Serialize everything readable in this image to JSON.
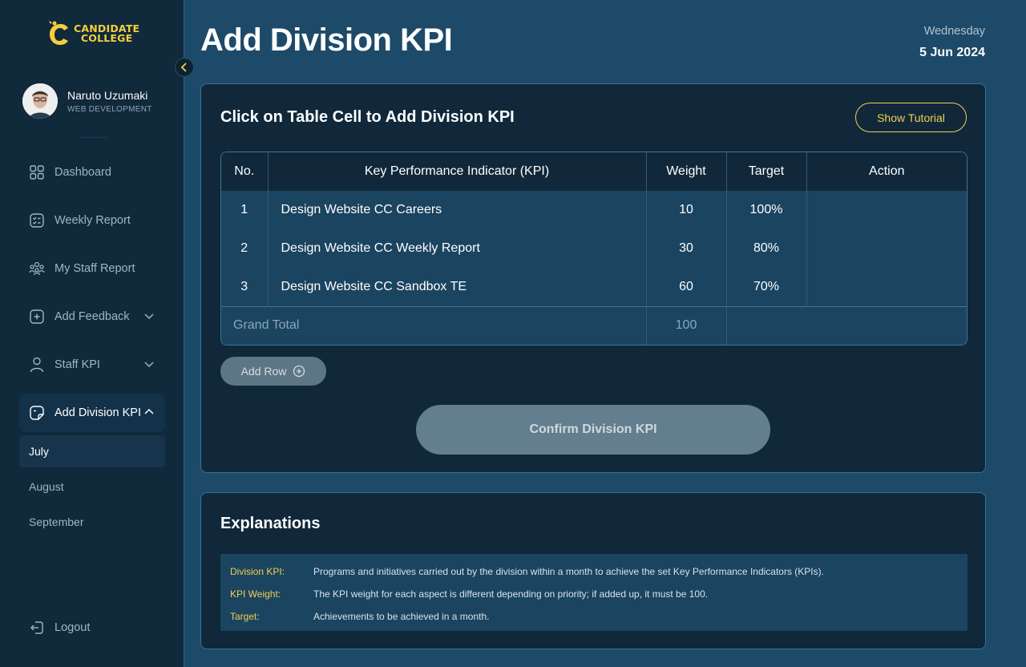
{
  "brand": {
    "line1": "CANDIDATE",
    "line2": "COLLEGE"
  },
  "profile": {
    "name": "Naruto Uzumaki",
    "role": "WEB DEVELOPMENT"
  },
  "nav": {
    "dashboard": "Dashboard",
    "weekly_report": "Weekly Report",
    "my_staff_report": "My Staff Report",
    "add_feedback": "Add Feedback",
    "staff_kpi": "Staff KPI",
    "add_division_kpi": "Add Division KPI",
    "logout": "Logout",
    "submenu": [
      "July",
      "August",
      "September"
    ]
  },
  "header": {
    "title": "Add Division KPI",
    "day": "Wednesday",
    "date": "5 Jun 2024"
  },
  "main": {
    "card_title": "Click on Table Cell to Add Division KPI",
    "tutorial_label": "Show Tutorial",
    "columns": [
      "No.",
      "Key Performance Indicator (KPI)",
      "Weight",
      "Target",
      "Action"
    ],
    "rows": [
      {
        "no": "1",
        "kpi": "Design Website CC Careers",
        "weight": "10",
        "target": "100%"
      },
      {
        "no": "2",
        "kpi": "Design Website CC Weekly Report",
        "weight": "30",
        "target": "80%"
      },
      {
        "no": "3",
        "kpi": "Design Website CC Sandbox TE",
        "weight": "60",
        "target": "70%"
      }
    ],
    "grand_total_label": "Grand Total",
    "grand_total_weight": "100",
    "add_row_label": "Add Row",
    "confirm_label": "Confirm Division KPI"
  },
  "explanations": {
    "title": "Explanations",
    "items": [
      {
        "term": "Division KPI:",
        "def": "Programs and initiatives carried out by the division within a month to achieve the set Key Performance Indicators (KPIs)."
      },
      {
        "term": "KPI Weight:",
        "def": "The KPI weight for each aspect is different depending on priority; if added up, it must be 100."
      },
      {
        "term": "Target:",
        "def": "Achievements to be achieved in a month."
      }
    ]
  },
  "colors": {
    "accent": "#f2cf50",
    "sidebar": "#10293b",
    "background": "#1d4a68",
    "card": "#10283a"
  },
  "icons": [
    "dashboard-grid-icon",
    "checklist-icon",
    "staff-group-icon",
    "plus-square-icon",
    "user-icon",
    "document-icon",
    "logout-icon",
    "chevron-left-icon",
    "chevron-down-icon",
    "chevron-up-icon",
    "plus-circle-icon"
  ]
}
